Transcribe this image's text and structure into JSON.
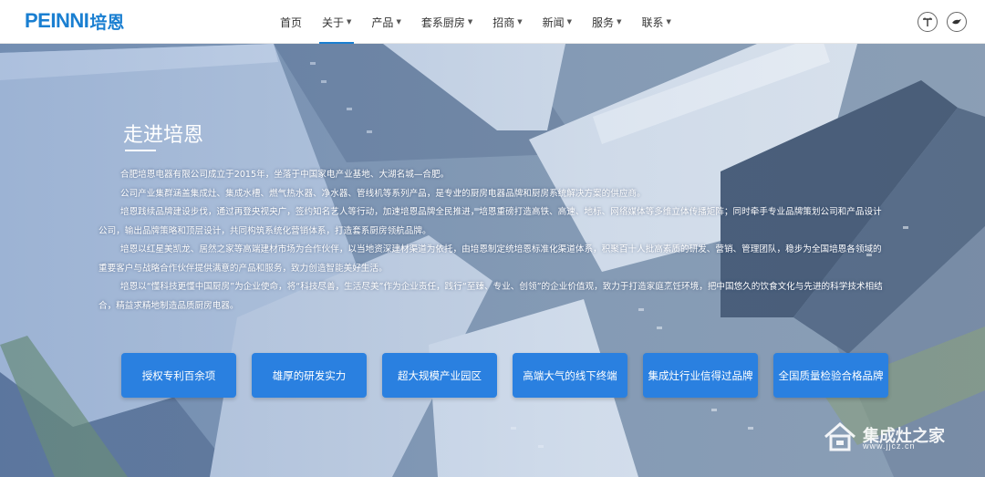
{
  "header": {
    "logo_latin": "PEINNI",
    "logo_cn": "培恩",
    "nav": [
      {
        "label": "首页",
        "dropdown": false,
        "active": false
      },
      {
        "label": "关于",
        "dropdown": true,
        "active": true
      },
      {
        "label": "产品",
        "dropdown": true,
        "active": false
      },
      {
        "label": "套系厨房",
        "dropdown": true,
        "active": false
      },
      {
        "label": "招商",
        "dropdown": true,
        "active": false
      },
      {
        "label": "新闻",
        "dropdown": true,
        "active": false
      },
      {
        "label": "服务",
        "dropdown": true,
        "active": false
      },
      {
        "label": "联系",
        "dropdown": true,
        "active": false
      }
    ],
    "icons": [
      "tmall-icon",
      "bird-icon"
    ]
  },
  "about": {
    "title": "走进培恩",
    "paragraphs": [
      "合肥培恩电器有限公司成立于2015年，坐落于中国家电产业基地、大湖名城—合肥。",
      "公司产业集群涵盖集成灶、集成水槽、燃气热水器、净水器、管线机等系列产品，是专业的厨房电器品牌和厨房系统解决方案的供应商。",
      "培恩践续品牌建设步伐，通过再登央视央广，签约知名艺人等行动，加速培恩品牌全民推进，培恩重磅打造高铁、高速、地标、网络媒体等多维立体传播矩阵；同时牵手专业品牌策划公司和产品设计公司，输出品牌策略和顶层设计，共同构筑系统化营销体系，打造套系厨房领航品牌。",
      "培恩以红星美凯龙、居然之家等高端建材市场为合作伙伴，以当地资深建材渠道为依托，由培恩制定统培恩标准化渠道体系，积聚百十人批高素质的研发、营销、管理团队，稳步为全国培恩各领域的重要客户与战略合作伙伴提供满意的产品和服务，致力创造智能美好生活。",
      "培恩以“懂科技更懂中国厨房”为企业使命，将“科技尽善，生活尽美”作为企业责任，践行“至臻、专业、创领”的企业价值观，致力于打造家庭烹饪环境，把中国悠久的饮食文化与先进的科学技术相结合，精益求精地制造品质厨房电器。"
    ]
  },
  "features": [
    "授权专利百余项",
    "雄厚的研发实力",
    "超大规模产业园区",
    "高端大气的线下终端",
    "集成灶行业信得过品牌",
    "全国质量检验合格品牌"
  ],
  "watermark": {
    "text": "集成灶之家",
    "url": "www.jjcz.cn"
  },
  "colors": {
    "brand": "#1a7fd1",
    "feature_button": "#2a80e0"
  }
}
